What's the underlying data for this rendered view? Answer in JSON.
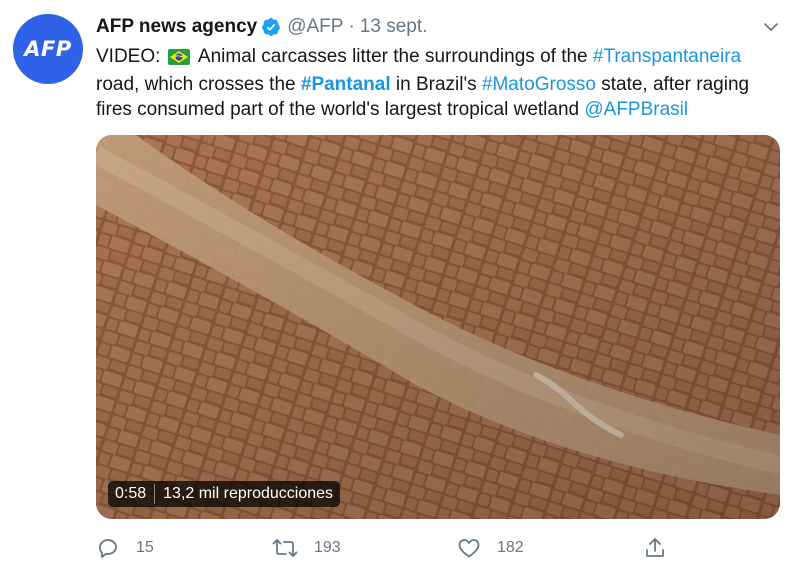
{
  "avatar_text": "AFP",
  "author": {
    "name": "AFP news agency",
    "handle": "@AFP",
    "separator": "·",
    "date": "13 sept."
  },
  "tweet": {
    "seg1": "VIDEO: ",
    "seg2": " Animal carcasses litter the surroundings of the ",
    "link1": "#Transpantaneira",
    "seg3": " road, which crosses the ",
    "link2": "#Pantanal",
    "seg4": " in Brazil's ",
    "link3": "#MatoGrosso",
    "seg5": " state, after raging fires consumed part of the world's largest tropical wetland ",
    "link4": "@AFPBrasil"
  },
  "media": {
    "duration": "0:58",
    "views": "13,2 mil reproducciones"
  },
  "actions": {
    "replies": "15",
    "retweets": "193",
    "likes": "182"
  },
  "colors": {
    "link": "#1b95e0",
    "verified": "#1da1f2",
    "avatar": "#2f62e8",
    "muted": "#657786"
  },
  "icons": [
    "verified-icon",
    "caret-down-icon",
    "brazil-flag-icon",
    "reply-icon",
    "retweet-icon",
    "like-icon",
    "share-icon"
  ]
}
